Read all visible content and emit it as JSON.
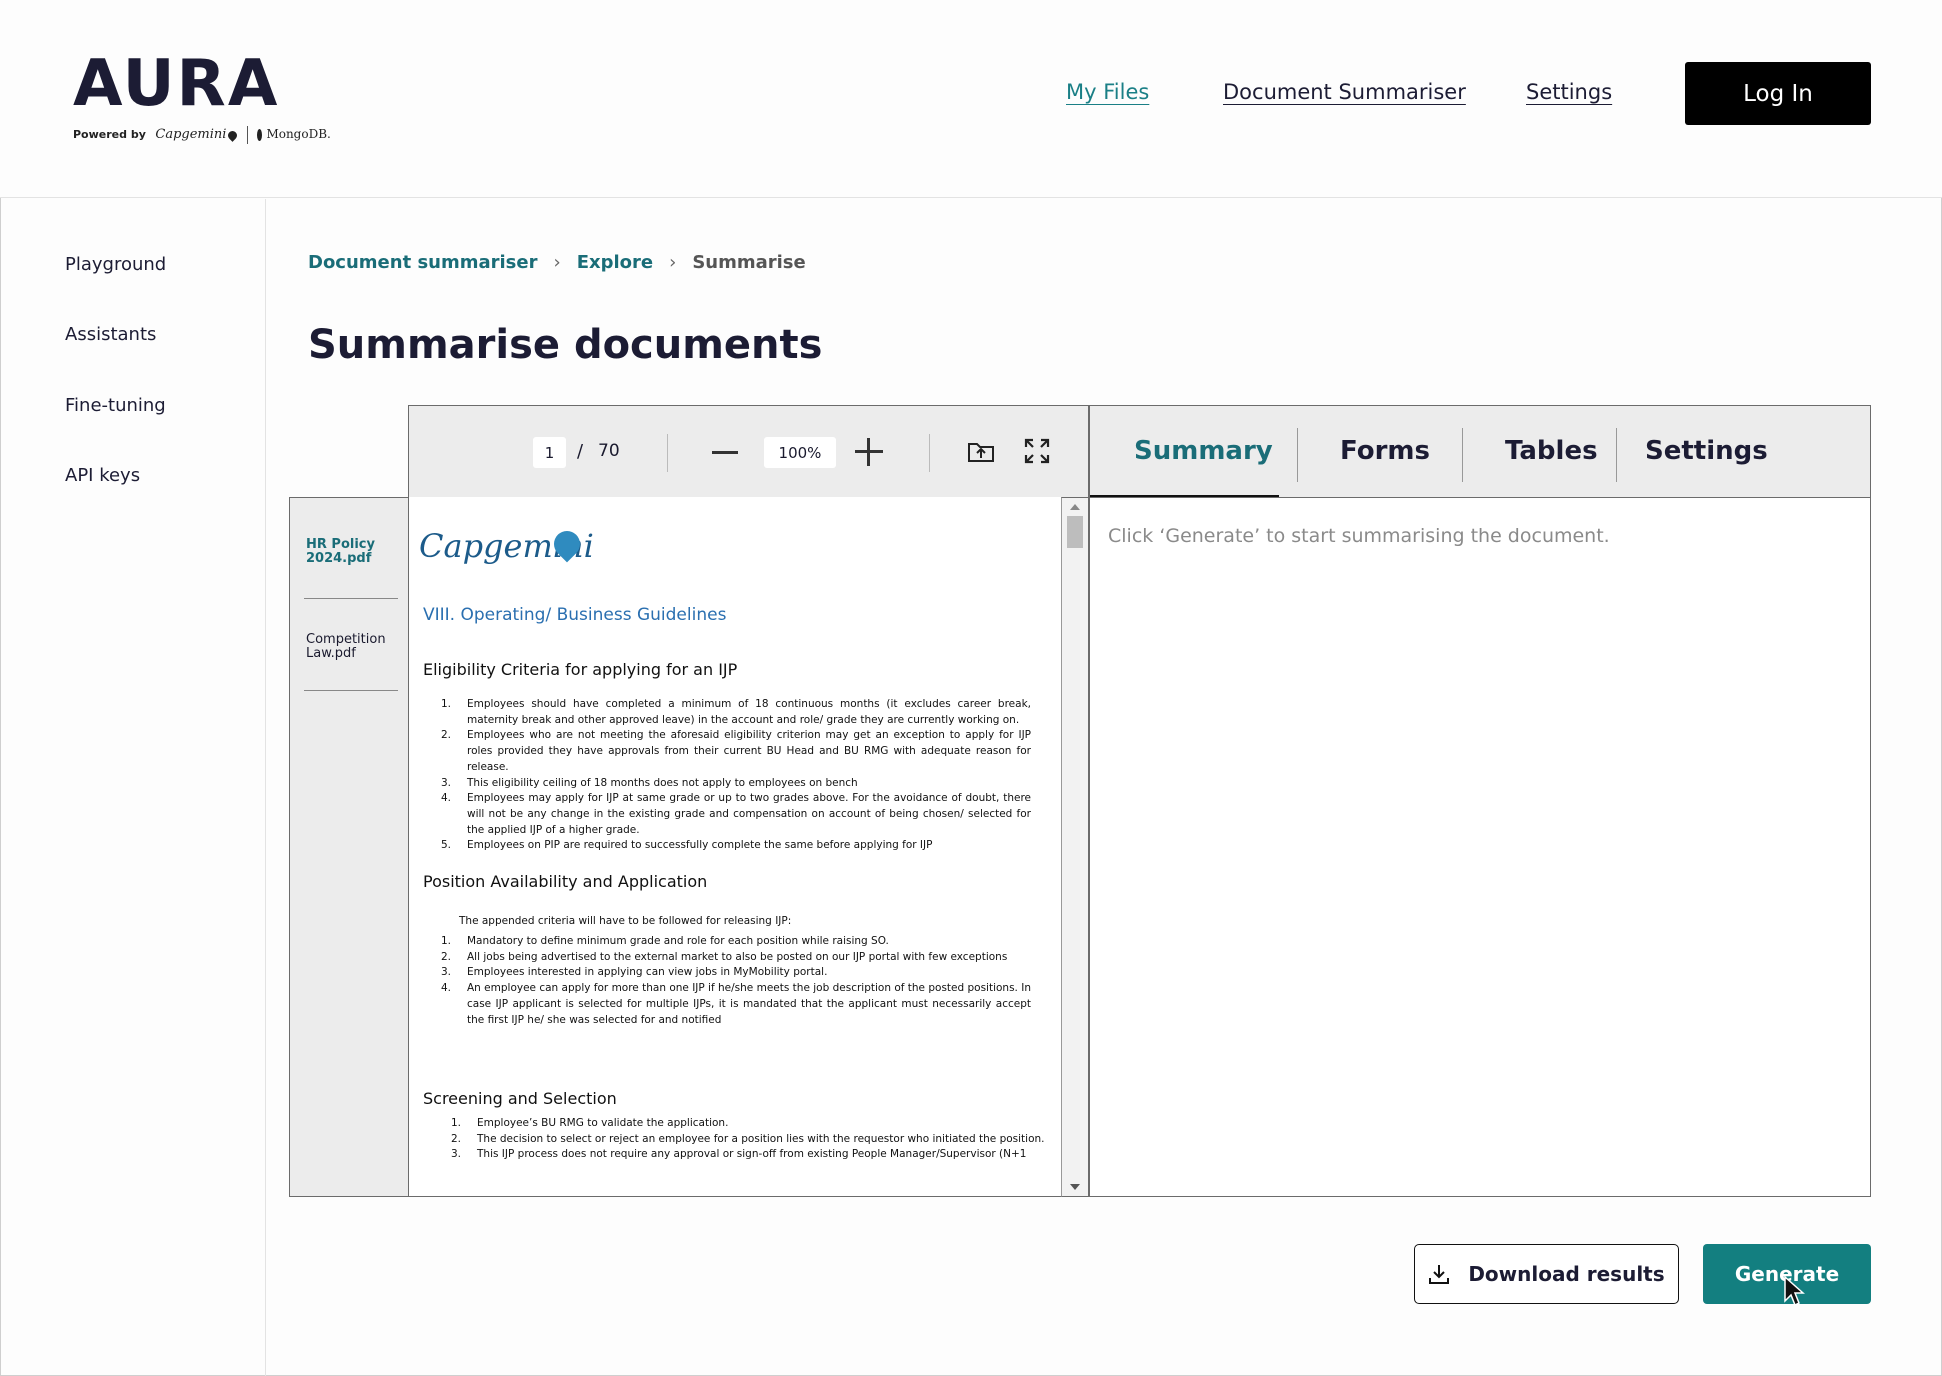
{
  "app": {
    "logo": "AURA",
    "powered_by": "Powered by",
    "partner_1": "Capgemini",
    "partner_2": "MongoDB."
  },
  "topnav": {
    "items": [
      {
        "label": "My Files",
        "active": true
      },
      {
        "label": "Document Summariser",
        "active": false
      },
      {
        "label": "Settings",
        "active": false
      }
    ],
    "login_label": "Log In"
  },
  "sidebar": {
    "items": [
      {
        "label": "Playground"
      },
      {
        "label": "Assistants"
      },
      {
        "label": "Fine-tuning"
      },
      {
        "label": "API keys"
      }
    ]
  },
  "breadcrumb": {
    "items": [
      "Document summariser",
      "Explore",
      "Summarise"
    ]
  },
  "page_title": "Summarise documents",
  "viewer": {
    "current_page": "1",
    "separator": "/",
    "total_pages": "70",
    "zoom": "100%",
    "files": [
      {
        "label": "HR Policy 2024.pdf",
        "active": true
      },
      {
        "label": "Competition Law.pdf",
        "active": false
      }
    ]
  },
  "document": {
    "logo": "Capgemini",
    "heading": "VIII. Operating/ Business Guidelines",
    "sections": [
      {
        "title": "Eligibility Criteria for applying for an IJP",
        "items": [
          {
            "num": "1.",
            "text": "Employees should have completed a minimum of 18 continuous months (it excludes career break, maternity break and other approved leave) in the account and role/ grade they are currently working on."
          },
          {
            "num": "2.",
            "text": "Employees who are not meeting the aforesaid eligibility criterion may get an exception to apply for IJP roles provided they have approvals from their current BU Head and BU RMG with adequate reason for release."
          },
          {
            "num": "3.",
            "text": "This eligibility ceiling of 18 months does not apply to employees on bench"
          },
          {
            "num": "4.",
            "text": "Employees may apply for IJP at same grade or up to two grades above. For the avoidance of doubt, there will not be any change in the existing grade and compensation on account of being chosen/ selected for the applied IJP of a higher grade."
          },
          {
            "num": "5.",
            "text": "Employees on PIP are required to successfully complete the same before applying for IJP"
          }
        ]
      },
      {
        "title": "Position Availability and Application",
        "intro": "The appended criteria will have to be followed for releasing IJP:",
        "items": [
          {
            "num": "1.",
            "text": "Mandatory to define minimum grade and role for each position while raising SO."
          },
          {
            "num": "2.",
            "text": "All jobs being advertised to the external market to also be posted on our IJP portal with few exceptions"
          },
          {
            "num": "3.",
            "text": "Employees interested in applying can view jobs in MyMobility portal."
          },
          {
            "num": "4.",
            "text": "An employee can apply for more than one IJP if he/she meets the job description of the posted positions. In case IJP applicant is selected for multiple IJPs, it is mandated that the applicant must necessarily accept the first IJP he/ she was selected for and notified"
          }
        ]
      },
      {
        "title": "Screening and Selection",
        "items": [
          {
            "num": "1.",
            "text": "Employee’s BU RMG to validate the application."
          },
          {
            "num": "2.",
            "text": "The decision to select or reject an employee for a position lies with the requestor who initiated the position."
          },
          {
            "num": "3.",
            "text": "This IJP process does not require any approval or sign-off from existing People Manager/Supervisor (N+1"
          }
        ]
      }
    ]
  },
  "tabs": {
    "items": [
      {
        "label": "Summary",
        "active": true
      },
      {
        "label": "Forms",
        "active": false
      },
      {
        "label": "Tables",
        "active": false
      },
      {
        "label": "Settings",
        "active": false
      }
    ]
  },
  "summary": {
    "hint": "Click ‘Generate’ to start summarising the document."
  },
  "actions": {
    "download_label": "Download results",
    "generate_label": "Generate"
  },
  "colors": {
    "accent": "#137f80",
    "link": "#1a6d78",
    "doc_heading": "#2a6fb0"
  }
}
